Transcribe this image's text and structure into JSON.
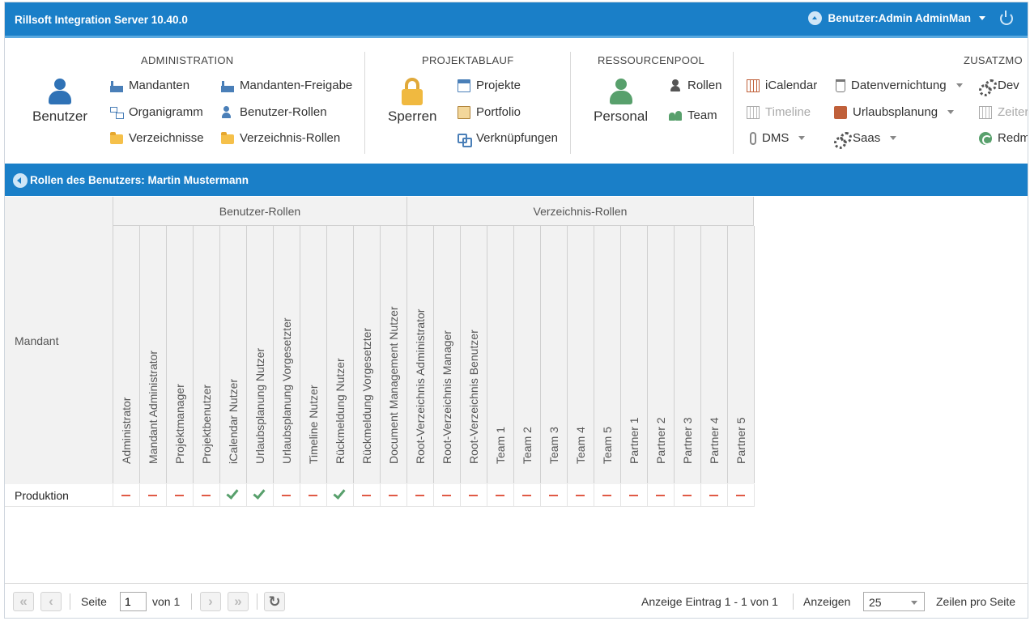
{
  "app": {
    "title": "Rillsoft Integration Server 10.40.0",
    "user_label": "Benutzer:Admin AdminMan"
  },
  "ribbon": {
    "administration": {
      "title": "ADMINISTRATION",
      "big_label": "Benutzer",
      "items": [
        "Mandanten",
        "Organigramm",
        "Verzeichnisse",
        "Mandanten-Freigabe",
        "Benutzer-Rollen",
        "Verzeichnis-Rollen"
      ]
    },
    "projektablauf": {
      "title": "PROJEKTABLAUF",
      "big_label": "Sperren",
      "items": [
        "Projekte",
        "Portfolio",
        "Verknüpfungen"
      ]
    },
    "ressourcenpool": {
      "title": "RESSOURCENPOOL",
      "big_label": "Personal",
      "items": [
        "Rollen",
        "Team"
      ]
    },
    "zusatzmodule": {
      "title": "ZUSATZMO",
      "items": [
        "iCalendar",
        "Timeline",
        "DMS",
        "Datenvernichtung",
        "Urlaubsplanung",
        "Saas",
        "Dev",
        "Zeiter",
        "Redm"
      ]
    }
  },
  "section": {
    "title": "Rollen des Benutzers: Martin Mustermann"
  },
  "grid": {
    "mandant_header": "Mandant",
    "groups": [
      "Benutzer-Rollen",
      "Verzeichnis-Rollen"
    ],
    "columns": [
      "Administrator",
      "Mandant Administrator",
      "Projektmanager",
      "Projektbenutzer",
      "iCalendar Nutzer",
      "Urlaubsplanung Nutzer",
      "Urlaubsplanung Vorgesetzter",
      "Timeline Nutzer",
      "Rückmeldung Nutzer",
      "Rückmeldung Vorgesetzter",
      "Document Management Nutzer",
      "Root-Verzeichnis Administrator",
      "Root-Verzeichnis Manager",
      "Root-Verzeichnis Benutzer",
      "Team 1",
      "Team 2",
      "Team 3",
      "Team 4",
      "Team 5",
      "Partner 1",
      "Partner 2",
      "Partner 3",
      "Partner 4",
      "Partner 5"
    ],
    "rows": [
      {
        "label": "Produktion",
        "values": [
          false,
          false,
          false,
          false,
          true,
          true,
          false,
          false,
          true,
          false,
          false,
          false,
          false,
          false,
          false,
          false,
          false,
          false,
          false,
          false,
          false,
          false,
          false,
          false
        ]
      }
    ]
  },
  "pager": {
    "page_label": "Seite",
    "page_value": "1",
    "of_label": "von 1",
    "entries": "Anzeige Eintrag 1 - 1 von 1",
    "show_label": "Anzeigen",
    "page_size": "25",
    "rows_per_page": "Zeilen pro Seite"
  },
  "colors": {
    "accent": "#1a7fc8",
    "check": "#58a06c",
    "dash": "#e05a45"
  }
}
